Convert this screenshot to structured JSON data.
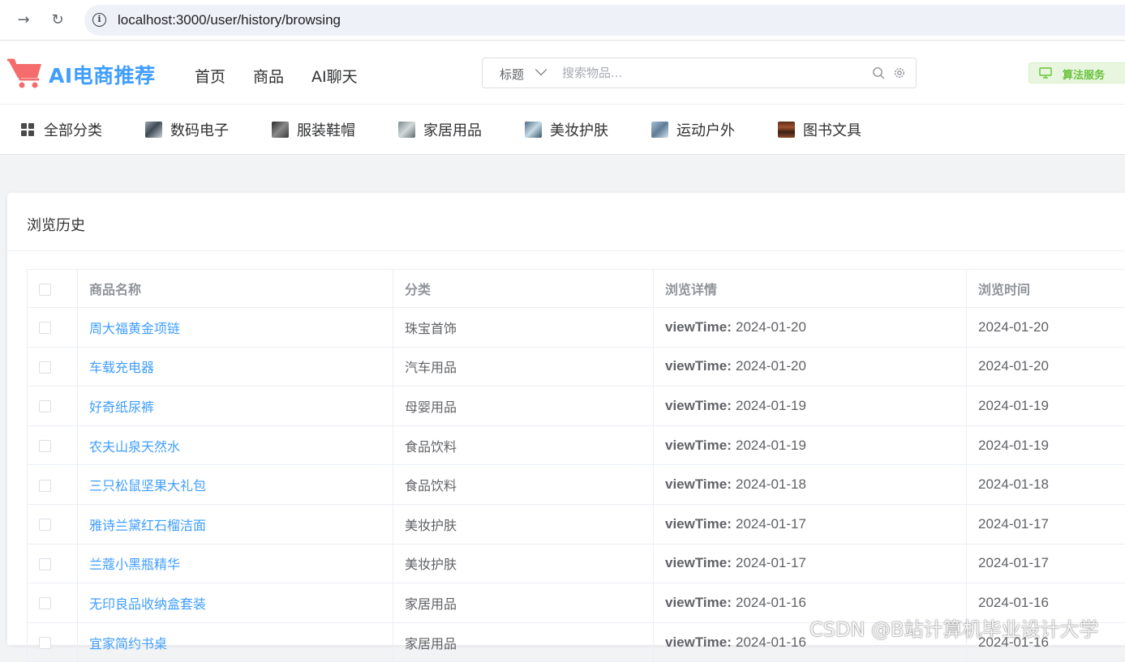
{
  "browser": {
    "url": "localhost:3000/user/history/browsing"
  },
  "header": {
    "logo": "AI电商推荐",
    "nav": [
      "首页",
      "商品",
      "AI聊天"
    ],
    "search": {
      "type_label": "标题",
      "placeholder": "搜索物品..."
    },
    "algo_button": "算法服务"
  },
  "categories": [
    {
      "label": "全部分类",
      "icon": "grid-icon"
    },
    {
      "label": "数码电子",
      "icon": "thumbnail-icon"
    },
    {
      "label": "服装鞋帽",
      "icon": "thumbnail-icon"
    },
    {
      "label": "家居用品",
      "icon": "thumbnail-icon"
    },
    {
      "label": "美妆护肤",
      "icon": "thumbnail-icon"
    },
    {
      "label": "运动户外",
      "icon": "thumbnail-icon"
    },
    {
      "label": "图书文具",
      "icon": "thumbnail-icon"
    }
  ],
  "page": {
    "title": "浏览历史"
  },
  "table": {
    "columns": [
      "商品名称",
      "分类",
      "浏览详情",
      "浏览时间"
    ],
    "detail_key": "viewTime:",
    "rows": [
      {
        "name": "周大福黄金项链",
        "category": "珠宝首饰",
        "detail": "2024-01-20",
        "time": "2024-01-20"
      },
      {
        "name": "车载充电器",
        "category": "汽车用品",
        "detail": "2024-01-20",
        "time": "2024-01-20"
      },
      {
        "name": "好奇纸尿裤",
        "category": "母婴用品",
        "detail": "2024-01-19",
        "time": "2024-01-19"
      },
      {
        "name": "农夫山泉天然水",
        "category": "食品饮料",
        "detail": "2024-01-19",
        "time": "2024-01-19"
      },
      {
        "name": "三只松鼠坚果大礼包",
        "category": "食品饮料",
        "detail": "2024-01-18",
        "time": "2024-01-18"
      },
      {
        "name": "雅诗兰黛红石榴洁面",
        "category": "美妆护肤",
        "detail": "2024-01-17",
        "time": "2024-01-17"
      },
      {
        "name": "兰蔻小黑瓶精华",
        "category": "美妆护肤",
        "detail": "2024-01-17",
        "time": "2024-01-17"
      },
      {
        "name": "无印良品收纳盒套装",
        "category": "家居用品",
        "detail": "2024-01-16",
        "time": "2024-01-16"
      },
      {
        "name": "宜家简约书桌",
        "category": "家居用品",
        "detail": "2024-01-16",
        "time": "2024-01-16"
      }
    ]
  },
  "watermark": "CSDN @B站计算机毕业设计大学",
  "colors": {
    "accent": "#409eff",
    "logo_cart": "#f56c6c",
    "algo_green": "#67c23a"
  }
}
